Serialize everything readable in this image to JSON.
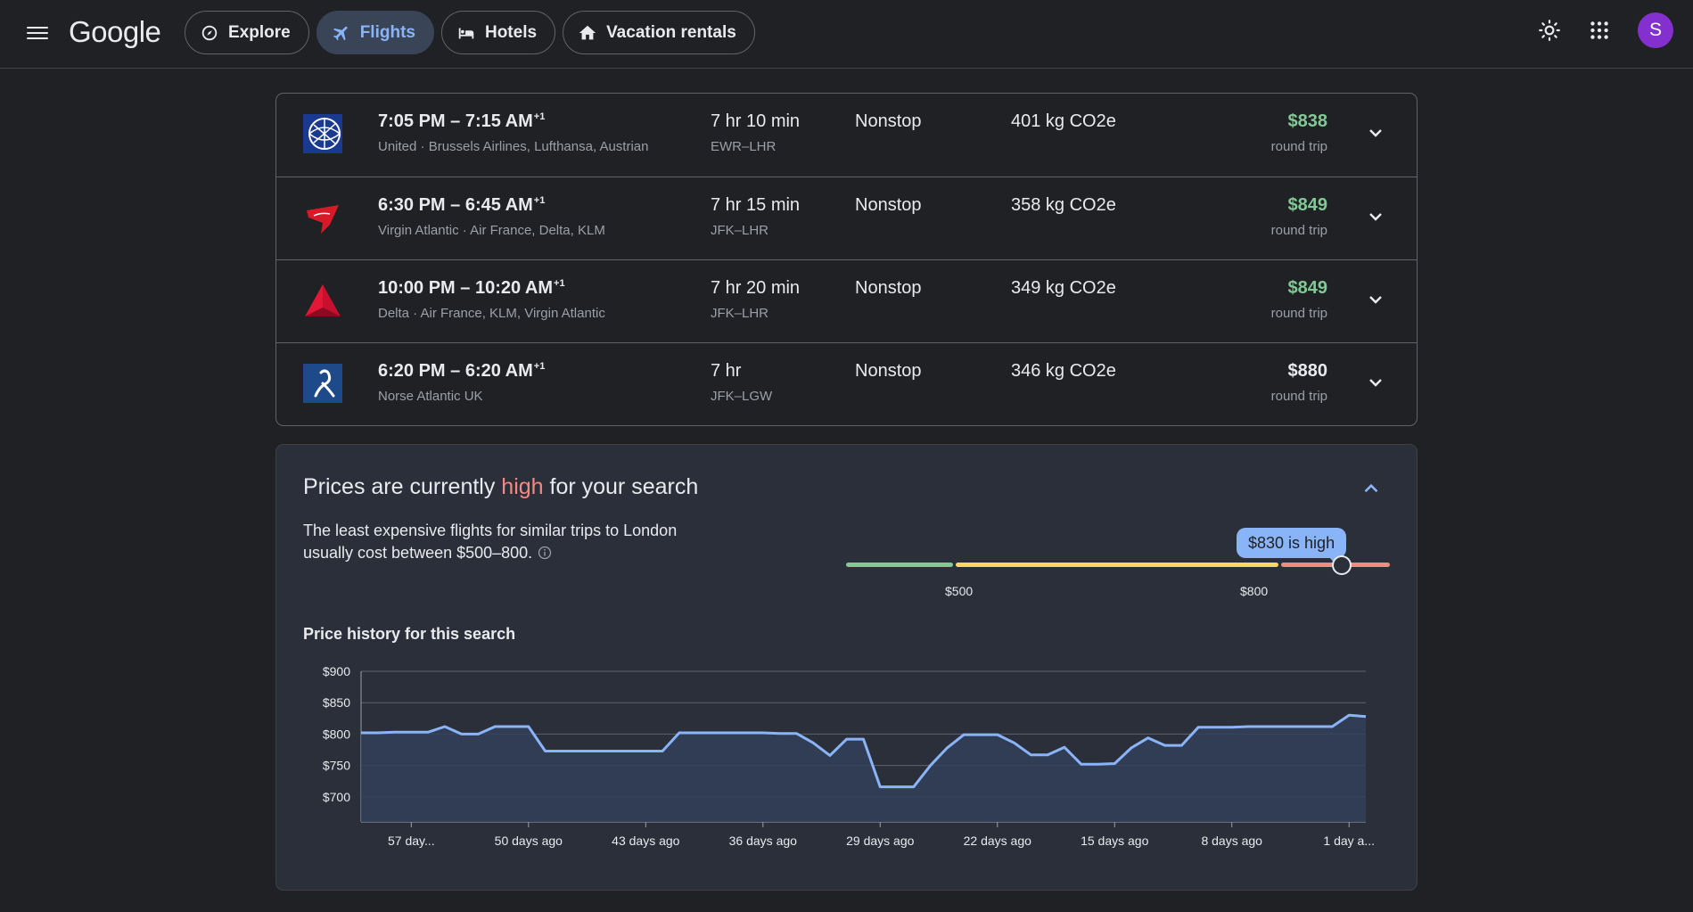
{
  "header": {
    "logo": "Google",
    "tabs": [
      {
        "label": "Explore",
        "icon": "explore-icon"
      },
      {
        "label": "Flights",
        "icon": "flight-icon",
        "active": true
      },
      {
        "label": "Hotels",
        "icon": "hotel-icon"
      },
      {
        "label": "Vacation rentals",
        "icon": "home-icon"
      }
    ],
    "avatar_letter": "S"
  },
  "flights": [
    {
      "times": "7:05 PM – 7:15 AM",
      "plus_day": "+1",
      "airlines": "United · Brussels Airlines, Lufthansa, Austrian",
      "duration": "7 hr 10 min",
      "route": "EWR–LHR",
      "stops": "Nonstop",
      "co2": "401 kg CO2e",
      "price": "$838",
      "price_color": "green",
      "trip": "round trip",
      "logo": "united-logo"
    },
    {
      "times": "6:30 PM – 6:45 AM",
      "plus_day": "+1",
      "airlines": "Virgin Atlantic · Air France, Delta, KLM",
      "duration": "7 hr 15 min",
      "route": "JFK–LHR",
      "stops": "Nonstop",
      "co2": "358 kg CO2e",
      "price": "$849",
      "price_color": "green",
      "trip": "round trip",
      "logo": "virgin-logo"
    },
    {
      "times": "10:00 PM – 10:20 AM",
      "plus_day": "+1",
      "airlines": "Delta · Air France, KLM, Virgin Atlantic",
      "duration": "7 hr 20 min",
      "route": "JFK–LHR",
      "stops": "Nonstop",
      "co2": "349 kg CO2e",
      "price": "$849",
      "price_color": "green",
      "trip": "round trip",
      "logo": "delta-logo"
    },
    {
      "times": "6:20 PM – 6:20 AM",
      "plus_day": "+1",
      "airlines": "Norse Atlantic UK",
      "duration": "7 hr",
      "route": "JFK–LGW",
      "stops": "Nonstop",
      "co2": "346 kg CO2e",
      "price": "$880",
      "price_color": "white",
      "trip": "round trip",
      "logo": "norse-logo"
    }
  ],
  "colors": {
    "green_price": "#81c995",
    "accent": "#8ab4f8",
    "high": "#f28b82",
    "low_bar": "#81c995",
    "typical_bar": "#fdd663"
  },
  "insight": {
    "title_before": "Prices are currently ",
    "title_highlight": "high",
    "title_after": " for your search",
    "description": "The least expensive flights for similar trips to London usually cost between $500–800.",
    "bubble": "$830 is high",
    "current_price": 830,
    "range_low_label": "$500",
    "range_high_label": "$800",
    "history_title": "Price history for this search"
  },
  "chart_data": {
    "type": "area",
    "title": "Price history for this search",
    "y_ticks": [
      900,
      850,
      800,
      750,
      700
    ],
    "y_tick_labels": [
      "$900",
      "$850",
      "$800",
      "$750",
      "$700"
    ],
    "ylim": [
      670,
      900
    ],
    "x_tick_labels": [
      "57 day...",
      "50 days ago",
      "43 days ago",
      "36 days ago",
      "29 days ago",
      "22 days ago",
      "15 days ago",
      "8 days ago",
      "1 day a..."
    ],
    "x_tick_days_ago": [
      57,
      50,
      43,
      36,
      29,
      22,
      15,
      8,
      1
    ],
    "xlim_days_ago": [
      60,
      0
    ],
    "series": [
      {
        "days_ago": [
          60,
          59,
          58,
          57,
          56,
          55,
          54,
          53,
          52,
          51,
          50,
          49,
          48,
          47,
          46,
          45,
          44,
          43,
          42,
          41,
          40,
          39,
          38,
          37,
          36,
          35,
          34,
          33,
          32,
          31,
          30,
          29,
          28,
          27,
          26,
          25,
          24,
          23,
          22,
          21,
          20,
          19,
          18,
          17,
          16,
          15,
          14,
          13,
          12,
          11,
          10,
          9,
          8,
          7,
          6,
          5,
          4,
          3,
          2,
          1,
          0
        ],
        "values": [
          802,
          802,
          803,
          803,
          803,
          812,
          800,
          800,
          812,
          812,
          812,
          773,
          773,
          773,
          773,
          773,
          773,
          773,
          773,
          802,
          802,
          802,
          802,
          802,
          802,
          801,
          801,
          786,
          766,
          792,
          792,
          716,
          716,
          716,
          750,
          778,
          799,
          799,
          799,
          786,
          767,
          767,
          779,
          752,
          752,
          753,
          778,
          794,
          782,
          782,
          811,
          811,
          811,
          812,
          812,
          812,
          812,
          812,
          812,
          830,
          828,
          828,
          828,
          830
        ]
      }
    ]
  }
}
